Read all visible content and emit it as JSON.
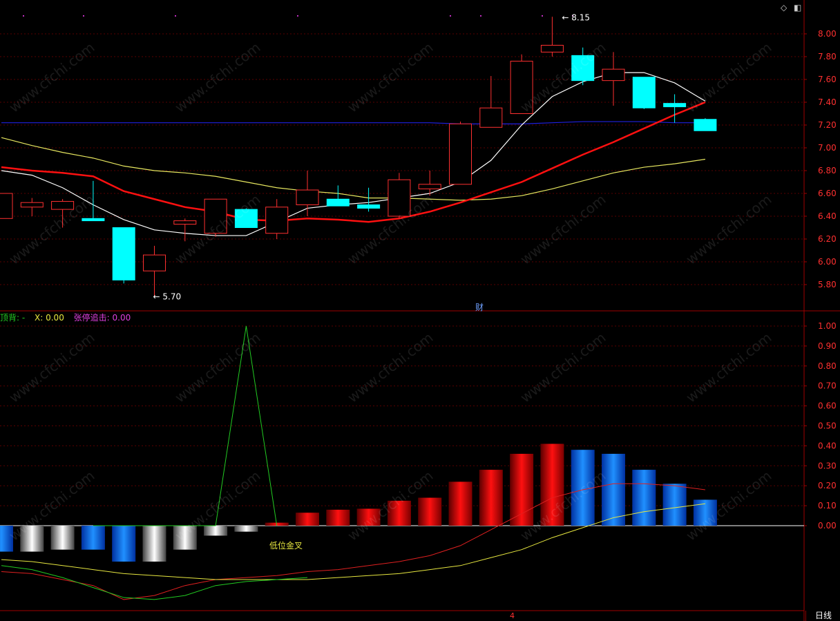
{
  "price_panel": {
    "high_marker": "8.15",
    "low_marker": "5.70",
    "cai_tag": "财"
  },
  "indicator_panel": {
    "title_items": [
      {
        "text": "顶背: -",
        "color": "#22cc22"
      },
      {
        "text": "X: 0.00",
        "color": "#e8e840"
      },
      {
        "text": "张停追击: 0.00",
        "color": "#e040e0"
      }
    ],
    "annotation": "低位金叉"
  },
  "footer": {
    "period_button": "日线",
    "date_marker": "4"
  },
  "corner_icons": [
    "diamond-icon",
    "panel-toggle-icon"
  ],
  "watermark_text": "www.cfchi.com",
  "colors": {
    "up": "#ff3030",
    "down": "#00ffff",
    "ma5": "#ffffff",
    "ma10": "#ff1010",
    "ma20": "#e8e860",
    "ma_long": "#2020e0",
    "axis": "#a00000",
    "tick_text": "#ff3030"
  },
  "chart_data": [
    {
      "type": "candlestick",
      "ylim": [
        5.6,
        8.1
      ],
      "y_ticks": [
        "8.00",
        "7.80",
        "7.60",
        "7.40",
        "7.20",
        "7.00",
        "6.80",
        "6.60",
        "6.40",
        "6.20",
        "6.00",
        "5.80"
      ],
      "candles": [
        {
          "o": 6.38,
          "h": 6.6,
          "l": 6.38,
          "c": 6.6
        },
        {
          "o": 6.48,
          "h": 6.56,
          "l": 6.4,
          "c": 6.52
        },
        {
          "o": 6.46,
          "h": 6.55,
          "l": 6.3,
          "c": 6.53
        },
        {
          "o": 6.38,
          "h": 6.71,
          "l": 6.36,
          "c": 6.36
        },
        {
          "o": 6.3,
          "h": 6.3,
          "l": 5.81,
          "c": 5.84
        },
        {
          "o": 5.92,
          "h": 6.14,
          "l": 5.7,
          "c": 6.06
        },
        {
          "o": 6.33,
          "h": 6.38,
          "l": 6.18,
          "c": 6.36
        },
        {
          "o": 6.25,
          "h": 6.55,
          "l": 6.22,
          "c": 6.55
        },
        {
          "o": 6.46,
          "h": 6.47,
          "l": 6.3,
          "c": 6.3
        },
        {
          "o": 6.25,
          "h": 6.55,
          "l": 6.2,
          "c": 6.48
        },
        {
          "o": 6.5,
          "h": 6.8,
          "l": 6.4,
          "c": 6.63
        },
        {
          "o": 6.55,
          "h": 6.67,
          "l": 6.5,
          "c": 6.49
        },
        {
          "o": 6.5,
          "h": 6.65,
          "l": 6.44,
          "c": 6.47
        },
        {
          "o": 6.4,
          "h": 6.78,
          "l": 6.38,
          "c": 6.72
        },
        {
          "o": 6.64,
          "h": 6.8,
          "l": 6.58,
          "c": 6.68
        },
        {
          "o": 6.68,
          "h": 7.23,
          "l": 6.68,
          "c": 7.21
        },
        {
          "o": 7.18,
          "h": 7.63,
          "l": 7.18,
          "c": 7.35
        },
        {
          "o": 7.3,
          "h": 7.82,
          "l": 7.3,
          "c": 7.76
        },
        {
          "o": 7.84,
          "h": 8.15,
          "l": 7.8,
          "c": 7.9
        },
        {
          "o": 7.81,
          "h": 7.88,
          "l": 7.55,
          "c": 7.59
        },
        {
          "o": 7.59,
          "h": 7.84,
          "l": 7.37,
          "c": 7.69
        },
        {
          "o": 7.62,
          "h": 7.62,
          "l": 7.34,
          "c": 7.35
        },
        {
          "o": 7.39,
          "h": 7.47,
          "l": 7.22,
          "c": 7.36
        },
        {
          "o": 7.25,
          "h": 7.26,
          "l": 7.15,
          "c": 7.15
        }
      ],
      "series": [
        {
          "values": [
            6.8,
            6.76,
            6.65,
            6.5,
            6.37,
            6.28,
            6.25,
            6.23,
            6.23,
            6.35,
            6.47,
            6.5,
            6.52,
            6.56,
            6.6,
            6.7,
            6.89,
            7.2,
            7.45,
            7.58,
            7.66,
            7.66,
            7.57,
            7.41
          ]
        },
        {
          "values": [
            6.83,
            6.8,
            6.78,
            6.75,
            6.62,
            6.55,
            6.48,
            6.44,
            6.37,
            6.36,
            6.38,
            6.37,
            6.35,
            6.38,
            6.44,
            6.52,
            6.61,
            6.7,
            6.82,
            6.94,
            7.05,
            7.17,
            7.29,
            7.4
          ]
        },
        {
          "values": [
            7.09,
            7.02,
            6.96,
            6.91,
            6.84,
            6.8,
            6.78,
            6.75,
            6.7,
            6.65,
            6.62,
            6.6,
            6.56,
            6.56,
            6.55,
            6.54,
            6.55,
            6.58,
            6.64,
            6.71,
            6.78,
            6.83,
            6.86,
            6.9
          ]
        },
        {
          "values": [
            7.22,
            7.22,
            7.22,
            7.22,
            7.22,
            7.22,
            7.22,
            7.22,
            7.22,
            7.22,
            7.22,
            7.22,
            7.22,
            7.22,
            7.22,
            7.21,
            7.21,
            7.21,
            7.22,
            7.23,
            7.23,
            7.23,
            7.22,
            7.22
          ]
        }
      ]
    },
    {
      "type": "bar",
      "ylim": [
        -0.44,
        1.05
      ],
      "y_ticks": [
        "1.00",
        "0.90",
        "0.80",
        "0.70",
        "0.60",
        "0.50",
        "0.40",
        "0.30",
        "0.20",
        "0.10",
        "0.00"
      ],
      "values": [
        -0.13,
        -0.13,
        -0.12,
        -0.12,
        -0.18,
        -0.18,
        -0.12,
        -0.05,
        -0.03,
        0.015,
        0.065,
        0.08,
        0.085,
        0.125,
        0.14,
        0.22,
        0.28,
        0.36,
        0.41,
        0.38,
        0.36,
        0.28,
        0.21,
        0.13
      ],
      "bar_colors": [
        "blue",
        "gray",
        "gray",
        "blue",
        "blue",
        "gray",
        "gray",
        "gray",
        "gray",
        "red",
        "red",
        "red",
        "red",
        "red",
        "red",
        "red",
        "red",
        "red",
        "red",
        "blue",
        "blue",
        "blue",
        "blue",
        "blue"
      ],
      "series": [
        {
          "values": [
            -0.23,
            -0.24,
            -0.27,
            -0.3,
            -0.37,
            -0.35,
            -0.3,
            -0.27,
            -0.26,
            -0.25,
            -0.23,
            -0.22,
            -0.2,
            -0.18,
            -0.15,
            -0.1,
            -0.02,
            0.06,
            0.14,
            0.18,
            0.21,
            0.21,
            0.2,
            0.18
          ]
        },
        {
          "values": [
            -0.17,
            -0.18,
            -0.2,
            -0.22,
            -0.24,
            -0.25,
            -0.26,
            -0.27,
            -0.27,
            -0.27,
            -0.27,
            -0.26,
            -0.25,
            -0.24,
            -0.22,
            -0.2,
            -0.16,
            -0.12,
            -0.06,
            -0.01,
            0.04,
            0.07,
            0.09,
            0.11
          ]
        },
        {
          "values": [
            -0.2,
            -0.22,
            -0.26,
            -0.31,
            -0.36,
            -0.37,
            -0.35,
            -0.3,
            -0.28,
            -0.27,
            -0.26
          ]
        },
        {
          "values": [
            0,
            0,
            0,
            0,
            0,
            1,
            0
          ]
        }
      ]
    }
  ]
}
